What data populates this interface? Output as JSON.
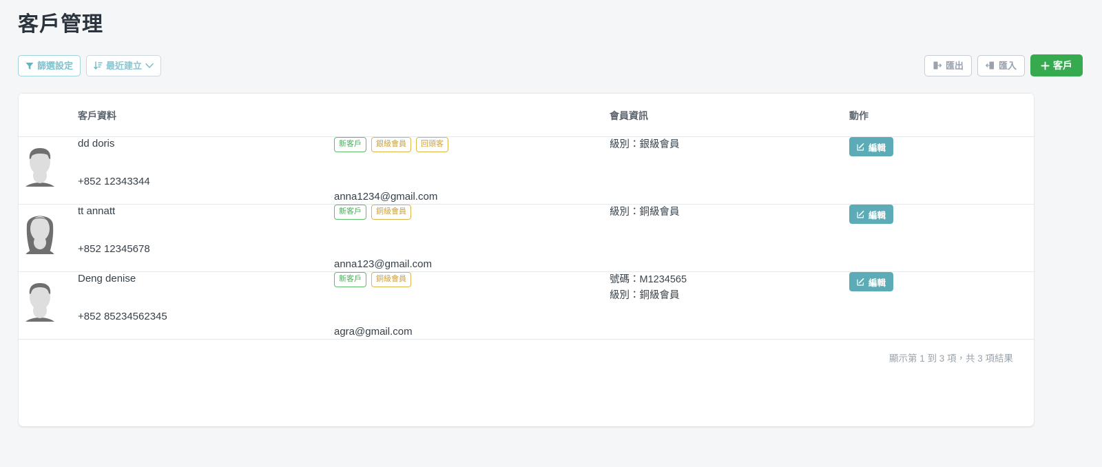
{
  "page": {
    "title": "客戶管理",
    "background_color": "#f4f6f8"
  },
  "toolbar": {
    "filter_button": {
      "label": "篩選設定",
      "icon": "filter-icon",
      "color": "#7fc3cf"
    },
    "sort_button": {
      "label": "最近建立",
      "icon": "sort-desc-icon",
      "caret": "chevron-down-icon",
      "color": "#8ac6d0"
    },
    "export_button": {
      "label": "匯出",
      "icon": "export-icon",
      "color": "#9aa3ab"
    },
    "import_button": {
      "label": "匯入",
      "icon": "import-icon",
      "color": "#9aa3ab"
    },
    "add_button": {
      "label": "客戶",
      "plus": "+",
      "icon": "plus-icon",
      "color": "#36aa4e"
    }
  },
  "table": {
    "columns": [
      "",
      "客戶資料",
      "",
      "會員資訊",
      "動作"
    ],
    "headers": {
      "customer": "客戶資料",
      "member": "會員資訊",
      "action": "動作"
    },
    "rows": [
      {
        "avatar": "avatar-male-placeholder",
        "name": "dd doris",
        "phone": "+852 12343344",
        "email": "anna1234@gmail.com",
        "tags": [
          {
            "label": "新客戶",
            "style": "green"
          },
          {
            "label": "銀級會員",
            "style": "gold"
          },
          {
            "label": "回頭客",
            "style": "gold"
          }
        ],
        "member_info": [
          "級別：銀級會員"
        ],
        "edit_label": "編輯"
      },
      {
        "avatar": "avatar-female-placeholder",
        "name": "tt annatt",
        "phone": "+852 12345678",
        "email": "anna123@gmail.com",
        "tags": [
          {
            "label": "新客戶",
            "style": "green"
          },
          {
            "label": "銅級會員",
            "style": "gold"
          }
        ],
        "member_info": [
          "級別：銅級會員"
        ],
        "edit_label": "編輯"
      },
      {
        "avatar": "avatar-male-placeholder",
        "name": "Deng denise",
        "phone": "+852 85234562345",
        "email": "agra@gmail.com",
        "tags": [
          {
            "label": "新客戶",
            "style": "green"
          },
          {
            "label": "銅級會員",
            "style": "gold"
          }
        ],
        "member_info": [
          "號碼：M1234565",
          "級別：銅級會員"
        ],
        "edit_label": "編輯"
      }
    ],
    "footer": "顯示第 1 到 3 項，共 3 項結果"
  }
}
